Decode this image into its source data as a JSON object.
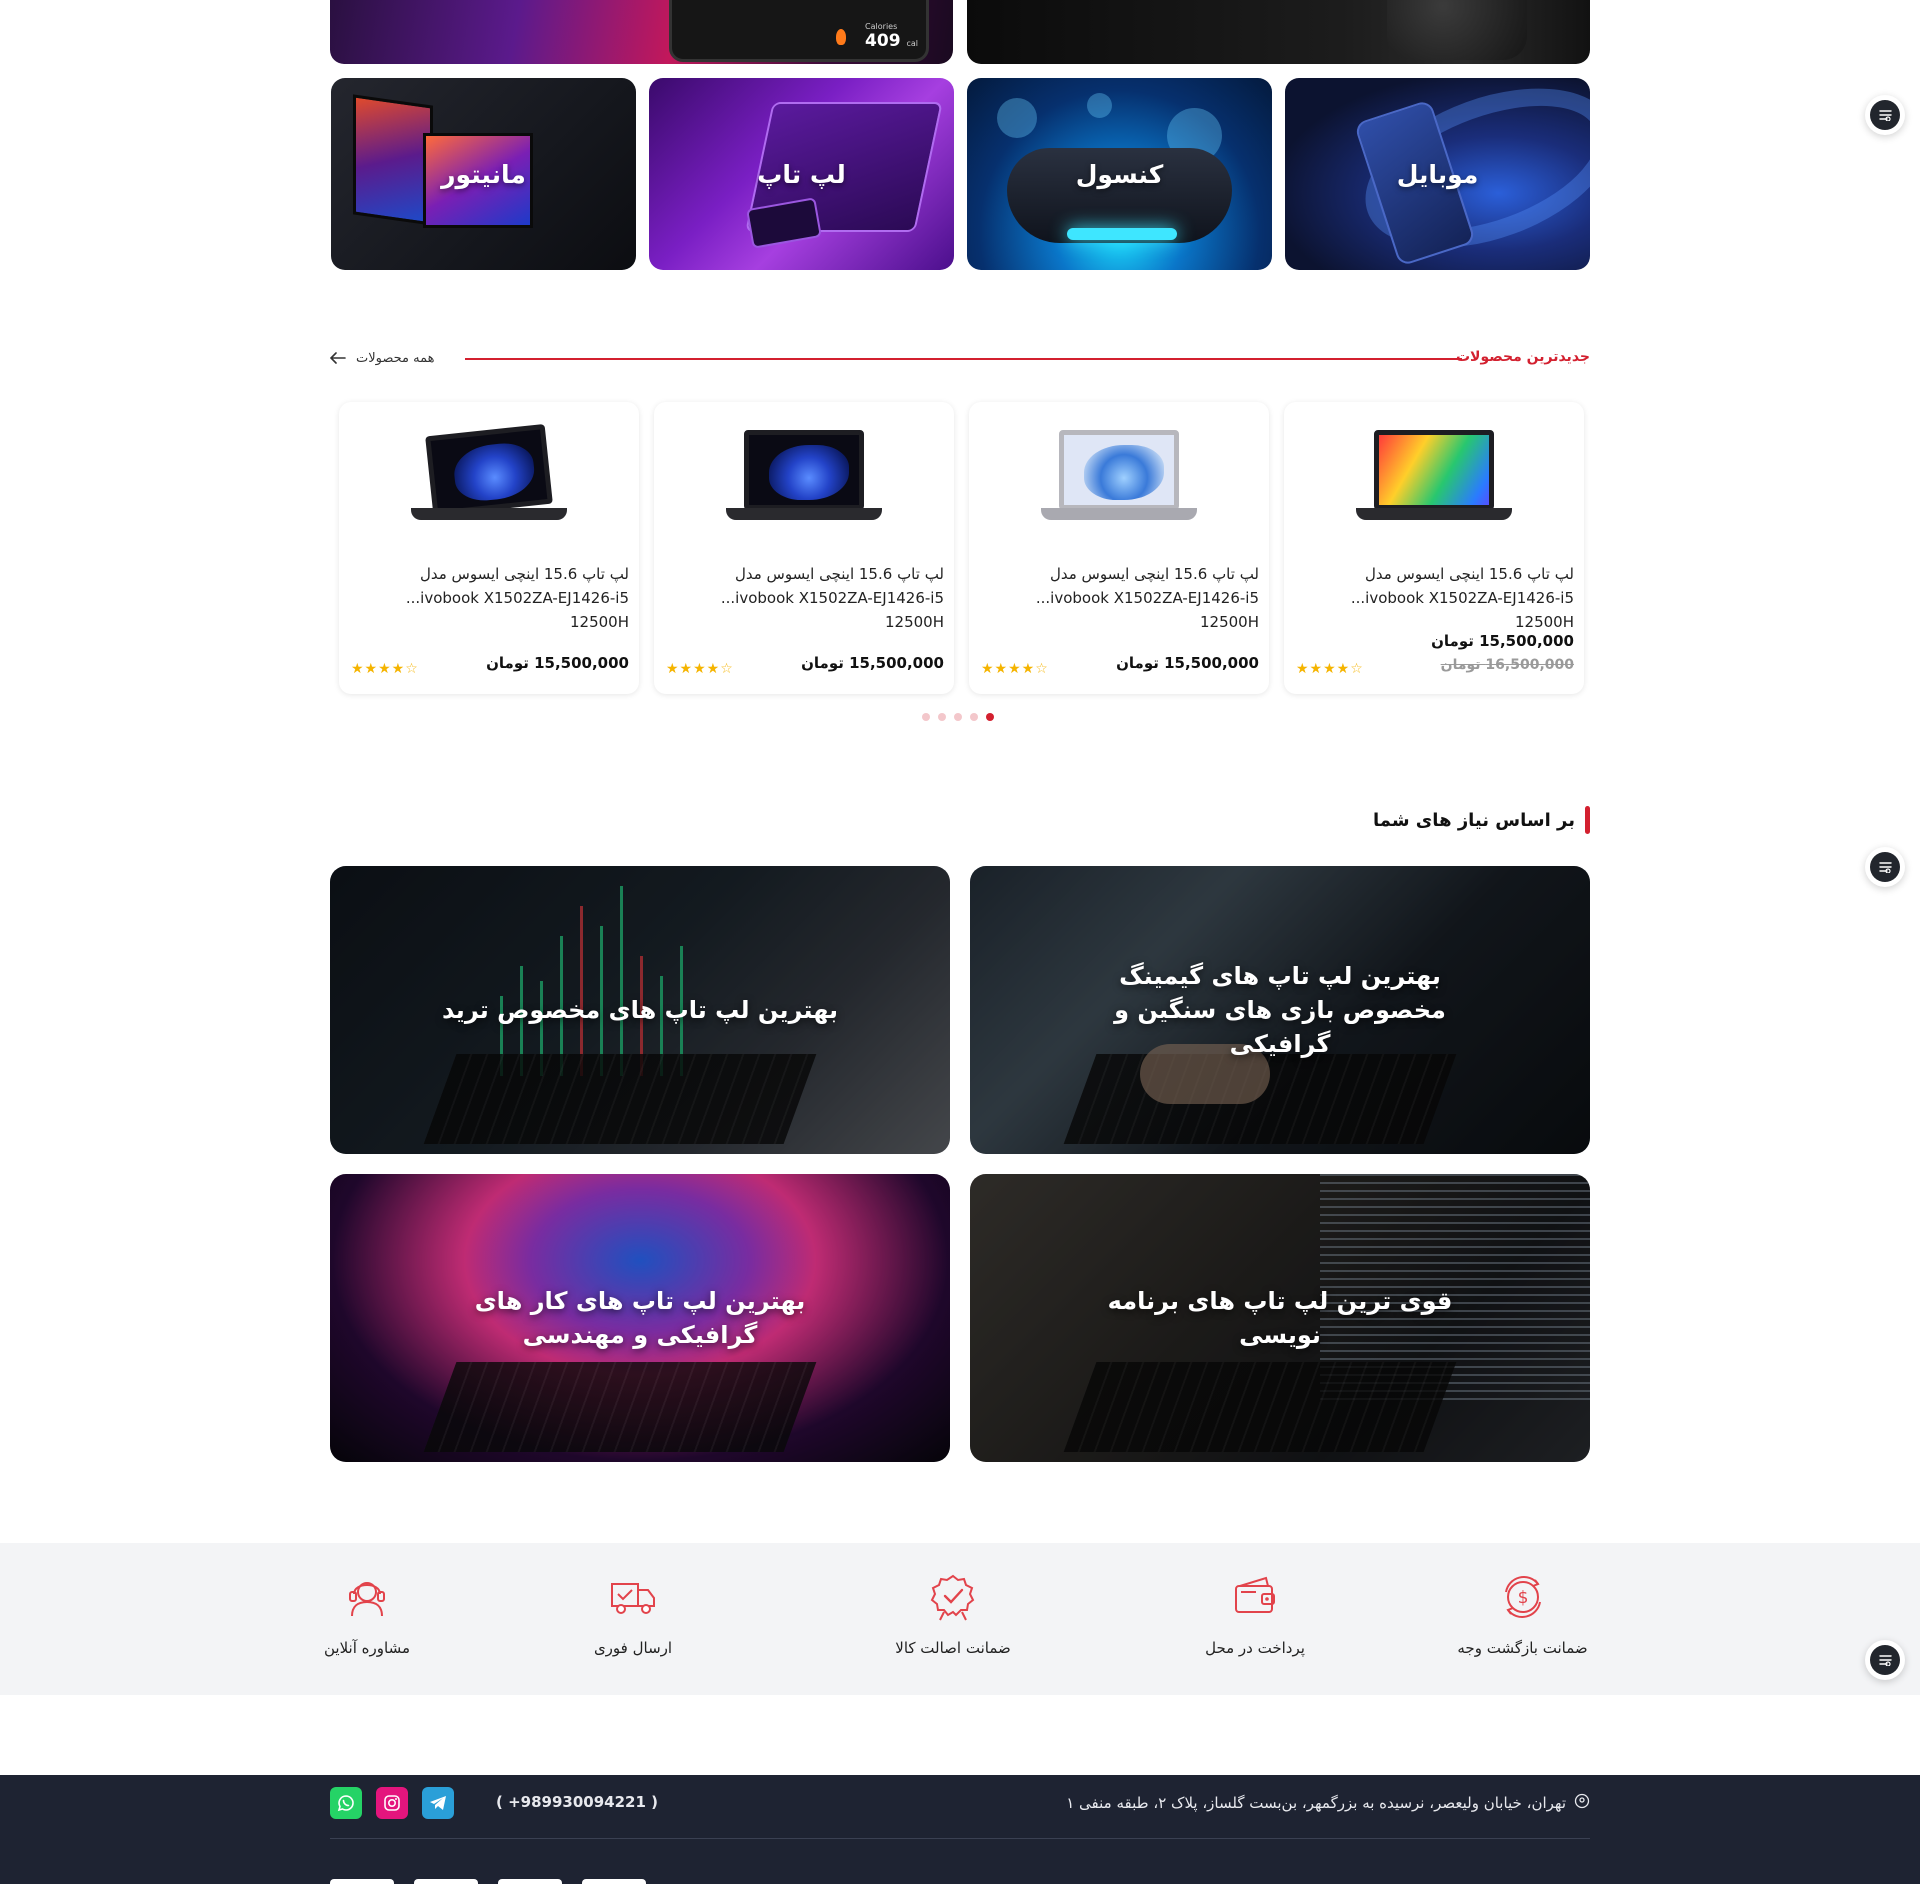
{
  "top_banners": {
    "watch": {
      "calories_label": "Calories",
      "calories_value": "409",
      "calories_unit": "cal"
    }
  },
  "categories": [
    {
      "label": "موبایل",
      "icon": "mobile"
    },
    {
      "label": "کنسول",
      "icon": "console"
    },
    {
      "label": "لپ تاپ",
      "icon": "laptop"
    },
    {
      "label": "مانیتور",
      "icon": "monitor"
    }
  ],
  "newest": {
    "title": "جدیدترین محصولات",
    "all_link": "همه محصولات",
    "products": [
      {
        "title_line1": "لپ تاپ 15.6 اینچی ایسوس مدل",
        "title_line2": "...ivobook X1502ZA-EJ1426-i5 12500H",
        "price": "15,500,000 تومان",
        "old_price": "16,500,000 تومان",
        "rating": 4
      },
      {
        "title_line1": "لپ تاپ 15.6 اینچی ایسوس مدل",
        "title_line2": "...ivobook X1502ZA-EJ1426-i5 12500H",
        "price": "15,500,000 تومان",
        "old_price": "",
        "rating": 4
      },
      {
        "title_line1": "لپ تاپ 15.6 اینچی ایسوس مدل",
        "title_line2": "...ivobook X1502ZA-EJ1426-i5 12500H",
        "price": "15,500,000 تومان",
        "old_price": "",
        "rating": 4
      },
      {
        "title_line1": "لپ تاپ 15.6 اینچی ایسوس مدل",
        "title_line2": "...ivobook X1502ZA-EJ1426-i5 12500H",
        "price": "15,500,000 تومان",
        "old_price": "",
        "rating": 4
      }
    ],
    "carousel_pages": 5,
    "carousel_active": 1
  },
  "needs": {
    "title": "بر اساس نیاز های شما",
    "items": [
      {
        "label": "بهترین لپ تاپ های گیمینگ مخصوص بازی های سنگین و گرافیکی"
      },
      {
        "label": "بهترین لپ تاپ های مخصوص ترید"
      },
      {
        "label": "قوی ترین لپ تاپ های برنامه نویسی"
      },
      {
        "label": "بهترین لپ تاپ های کار های گرافیکی و مهندسی"
      }
    ]
  },
  "features": [
    {
      "label": "ضمانت بازگشت وجه",
      "icon": "money-back-icon"
    },
    {
      "label": "پرداخت در محل",
      "icon": "wallet-icon"
    },
    {
      "label": "ضمانت اصالت کالا",
      "icon": "badge-icon"
    },
    {
      "label": "ارسال فوری",
      "icon": "truck-icon"
    },
    {
      "label": "مشاوره آنلاین",
      "icon": "support-icon"
    }
  ],
  "footer": {
    "address": "تهران، خیابان ولیعصر، نرسیده به بزرگمهر، بن‌بست گلساز، پلاک ۲، طبقه منفی ۱",
    "phone": "( +989930094221 )",
    "social": [
      "whatsapp",
      "instagram",
      "telegram"
    ]
  },
  "colors": {
    "accent": "#d3202f",
    "footer_bg": "#1e2332",
    "features_bg": "#f3f4f6",
    "star": "#f5b400"
  }
}
